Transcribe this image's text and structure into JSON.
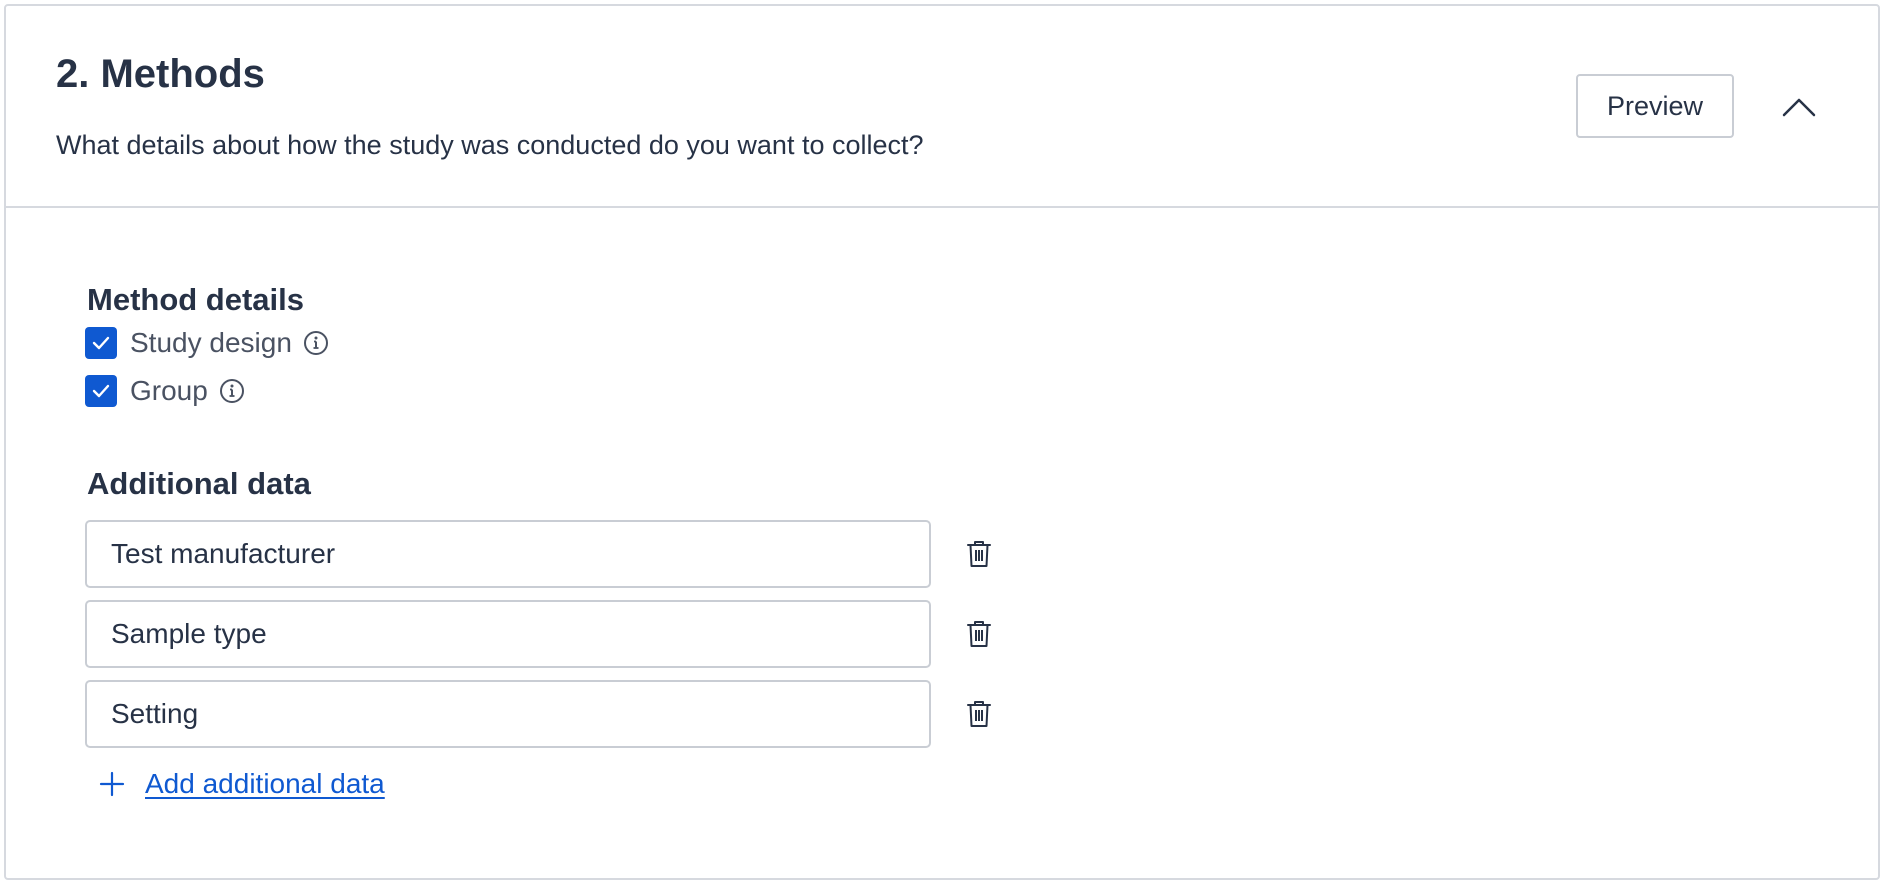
{
  "section": {
    "title": "2. Methods",
    "description": "What details about how the study was conducted do you want to collect?",
    "preview_label": "Preview",
    "collapse_icon": "chevron-up-icon"
  },
  "method_details": {
    "title": "Method details",
    "items": [
      {
        "label": "Study design",
        "checked": true,
        "icon": "info-icon"
      },
      {
        "label": "Group",
        "checked": true,
        "icon": "info-icon"
      }
    ]
  },
  "additional_data": {
    "title": "Additional data",
    "fields": [
      {
        "value": "Test manufacturer",
        "icon": "trash-icon"
      },
      {
        "value": "Sample type",
        "icon": "trash-icon"
      },
      {
        "value": "Setting",
        "icon": "trash-icon"
      }
    ],
    "add_label": "Add additional data",
    "add_icon": "plus-icon"
  },
  "colors": {
    "accent": "#0f59d1",
    "text": "#273246",
    "border": "#c9cdd4"
  }
}
